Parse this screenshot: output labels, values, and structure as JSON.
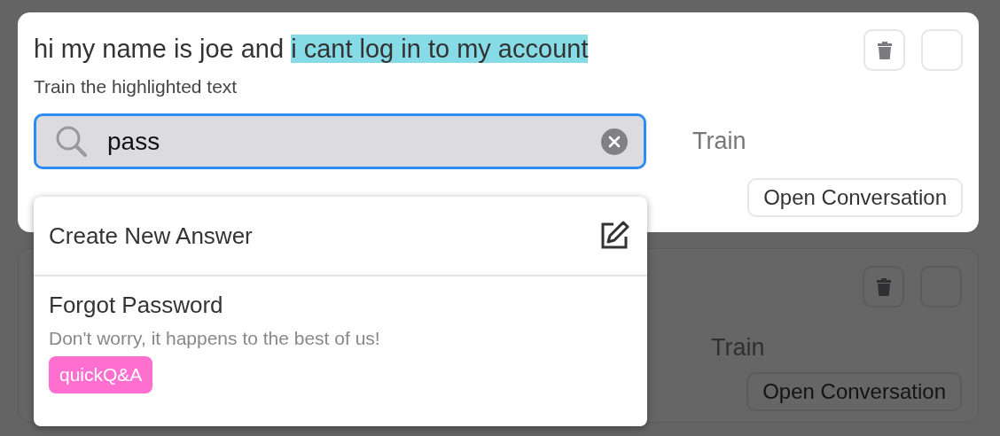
{
  "cards": [
    {
      "message": [
        {
          "text": "hi my name is joe and ",
          "highlighted": false
        },
        {
          "text": "i cant log in to my account",
          "highlighted": true
        }
      ],
      "hint": "Train the highlighted text",
      "search": {
        "value": "pass"
      },
      "train_label": "Train",
      "open_button": "Open Conversation",
      "dimmed": false
    },
    {
      "train_label": "Train",
      "open_button": "Open Conversation",
      "dimmed": true
    }
  ],
  "dropdown": {
    "create_label": "Create New Answer",
    "results": [
      {
        "title": "Forgot Password",
        "subtitle": "Don't worry, it happens to the best of us!",
        "tag": "quickQ&A"
      }
    ]
  }
}
